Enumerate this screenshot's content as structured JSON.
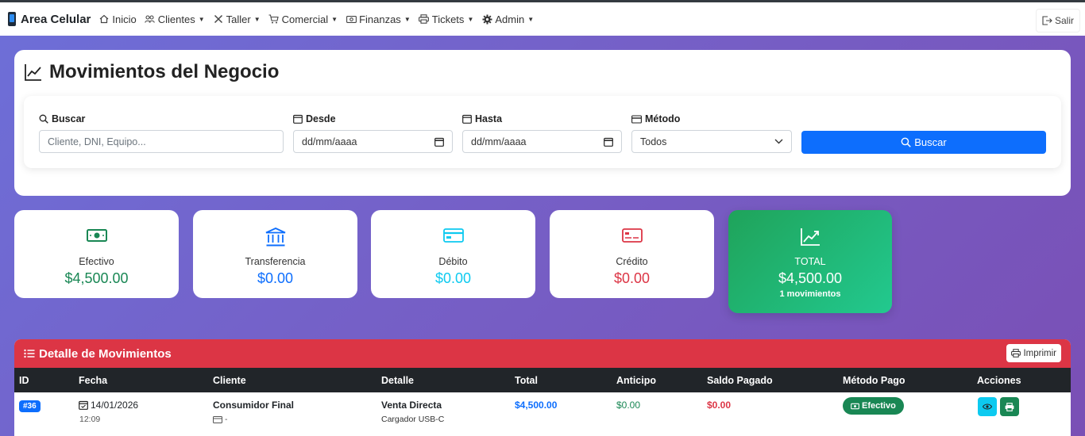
{
  "navbar": {
    "brand": "Area Celular",
    "items": [
      {
        "label": "Inicio",
        "icon": "home-icon",
        "dropdown": false
      },
      {
        "label": "Clientes",
        "icon": "users-icon",
        "dropdown": true
      },
      {
        "label": "Taller",
        "icon": "tools-icon",
        "dropdown": true
      },
      {
        "label": "Comercial",
        "icon": "cart-icon",
        "dropdown": true
      },
      {
        "label": "Finanzas",
        "icon": "cash-icon",
        "dropdown": true
      },
      {
        "label": "Tickets",
        "icon": "printer-icon",
        "dropdown": true
      },
      {
        "label": "Admin",
        "icon": "gear-icon",
        "dropdown": true
      }
    ],
    "logout": "Salir"
  },
  "page": {
    "title": "Movimientos del Negocio"
  },
  "filters": {
    "search": {
      "label": "Buscar",
      "placeholder": "Cliente, DNI, Equipo..."
    },
    "from": {
      "label": "Desde",
      "value": "dd/mm/aaaa"
    },
    "to": {
      "label": "Hasta",
      "value": "dd/mm/aaaa"
    },
    "method": {
      "label": "Método",
      "value": "Todos"
    },
    "submit": "Buscar"
  },
  "stats": {
    "efectivo": {
      "label": "Efectivo",
      "value": "$4,500.00",
      "color": "#198754"
    },
    "transferencia": {
      "label": "Transferencia",
      "value": "$0.00",
      "color": "#0d6efd"
    },
    "debito": {
      "label": "Débito",
      "value": "$0.00",
      "color": "#0dcaf0"
    },
    "credito": {
      "label": "Crédito",
      "value": "$0.00",
      "color": "#dc3545"
    },
    "total": {
      "label": "TOTAL",
      "value": "$4,500.00",
      "count": "1 movimientos"
    }
  },
  "detail": {
    "title": "Detalle de Movimientos",
    "print": "Imprimir",
    "columns": [
      "ID",
      "Fecha",
      "Cliente",
      "Detalle",
      "Total",
      "Anticipo",
      "Saldo Pagado",
      "Método Pago",
      "Acciones"
    ],
    "rows": [
      {
        "id": "#36",
        "date": "14/01/2026",
        "time": "12:09",
        "client": "Consumidor Final",
        "client_doc": "-",
        "detail": "Venta Directa",
        "detail_sub": "Cargador USB-C",
        "total": "$4,500.00",
        "advance": "$0.00",
        "paid_balance": "$0.00",
        "method": "Efectivo"
      }
    ]
  }
}
